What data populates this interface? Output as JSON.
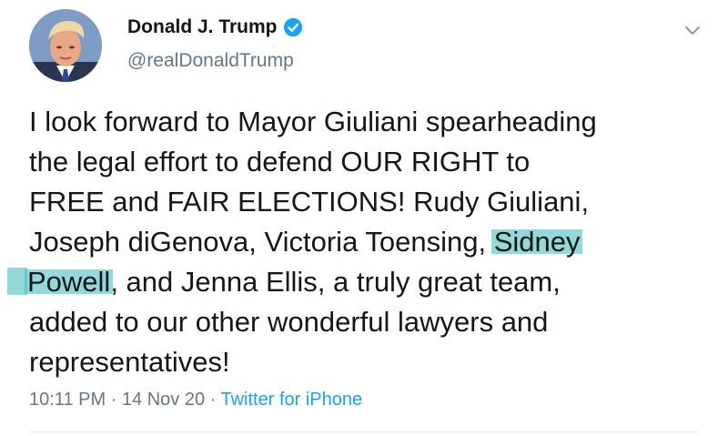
{
  "author": {
    "name": "Donald J. Trump",
    "handle": "@realDonaldTrump",
    "verified": true,
    "avatar_icon": "profile-photo"
  },
  "menu": {
    "icon": "chevron-down-icon"
  },
  "tweet": {
    "lines": [
      "I look forward to Mayor Giuliani spearheading",
      "the legal effort to defend OUR RIGHT to",
      "FREE and FAIR ELECTIONS! Rudy Giuliani,",
      "Joseph diGenova, Victoria Toensing, ",
      "Sidney",
      "Powell",
      ", and Jenna Ellis, a truly great team,",
      "added to our other wonderful lawyers and",
      "representatives!"
    ],
    "highlight_color": "#3cb9b9"
  },
  "meta": {
    "time": "10:11 PM",
    "separator": " · ",
    "date": "14 Nov 20",
    "source": "Twitter for iPhone"
  },
  "colors": {
    "text": "#14171a",
    "secondary": "#657786",
    "link": "#1da1f2",
    "verified": "#1da1f2"
  }
}
